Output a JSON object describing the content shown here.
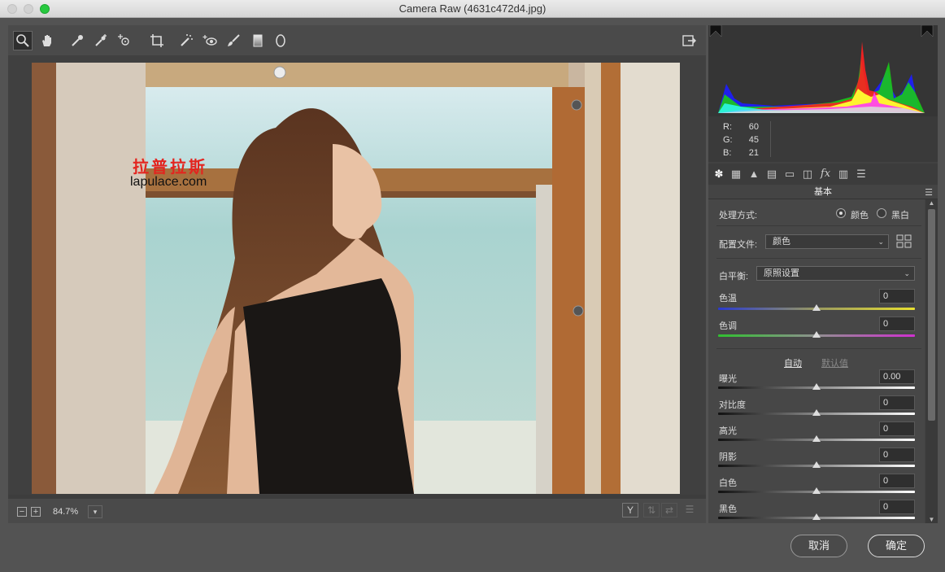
{
  "window": {
    "title": "Camera Raw (4631c472d4.jpg)"
  },
  "toolbar": {
    "tools": [
      "zoom-tool",
      "hand-tool",
      "white-balance-tool",
      "color-sampler-tool",
      "targeted-adjustment-tool",
      "crop-tool",
      "spot-removal-tool",
      "red-eye-tool",
      "adjustment-brush-tool",
      "graduated-filter-tool",
      "radial-filter-tool",
      "open-preferences"
    ]
  },
  "image": {
    "watermark_cn": "拉普拉斯",
    "watermark_en": "lapulace.com"
  },
  "bottombar": {
    "zoom_out": "−",
    "zoom_in": "+",
    "zoom": "84.7%",
    "view_y": "Y"
  },
  "readout": {
    "r_label": "R:",
    "r_value": "60",
    "g_label": "G:",
    "g_value": "45",
    "b_label": "B:",
    "b_value": "21"
  },
  "panel": {
    "tab_fx": "fx",
    "title": "基本",
    "process_label": "处理方式:",
    "process_color": "颜色",
    "process_bw": "黑白",
    "process_selected": "颜色",
    "profile_label": "配置文件:",
    "profile_value": "颜色",
    "wb_label": "白平衡:",
    "wb_value": "原照设置",
    "auto": "自动",
    "default": "默认值",
    "sliders": [
      {
        "label": "色温",
        "value": "0",
        "level": 0.5
      },
      {
        "label": "色调",
        "value": "0",
        "level": 0.5
      },
      {
        "label": "曝光",
        "value": "0.00",
        "level": 0.5
      },
      {
        "label": "对比度",
        "value": "0",
        "level": 0.5
      },
      {
        "label": "高光",
        "value": "0",
        "level": 0.5
      },
      {
        "label": "阴影",
        "value": "0",
        "level": 0.5
      },
      {
        "label": "白色",
        "value": "0",
        "level": 0.5
      },
      {
        "label": "黑色",
        "value": "0",
        "level": 0.5
      }
    ]
  },
  "buttons": {
    "cancel": "取消",
    "ok": "确定"
  },
  "colors": {
    "accent_green": "#27c93f",
    "watermark_red": "#e3251f"
  }
}
